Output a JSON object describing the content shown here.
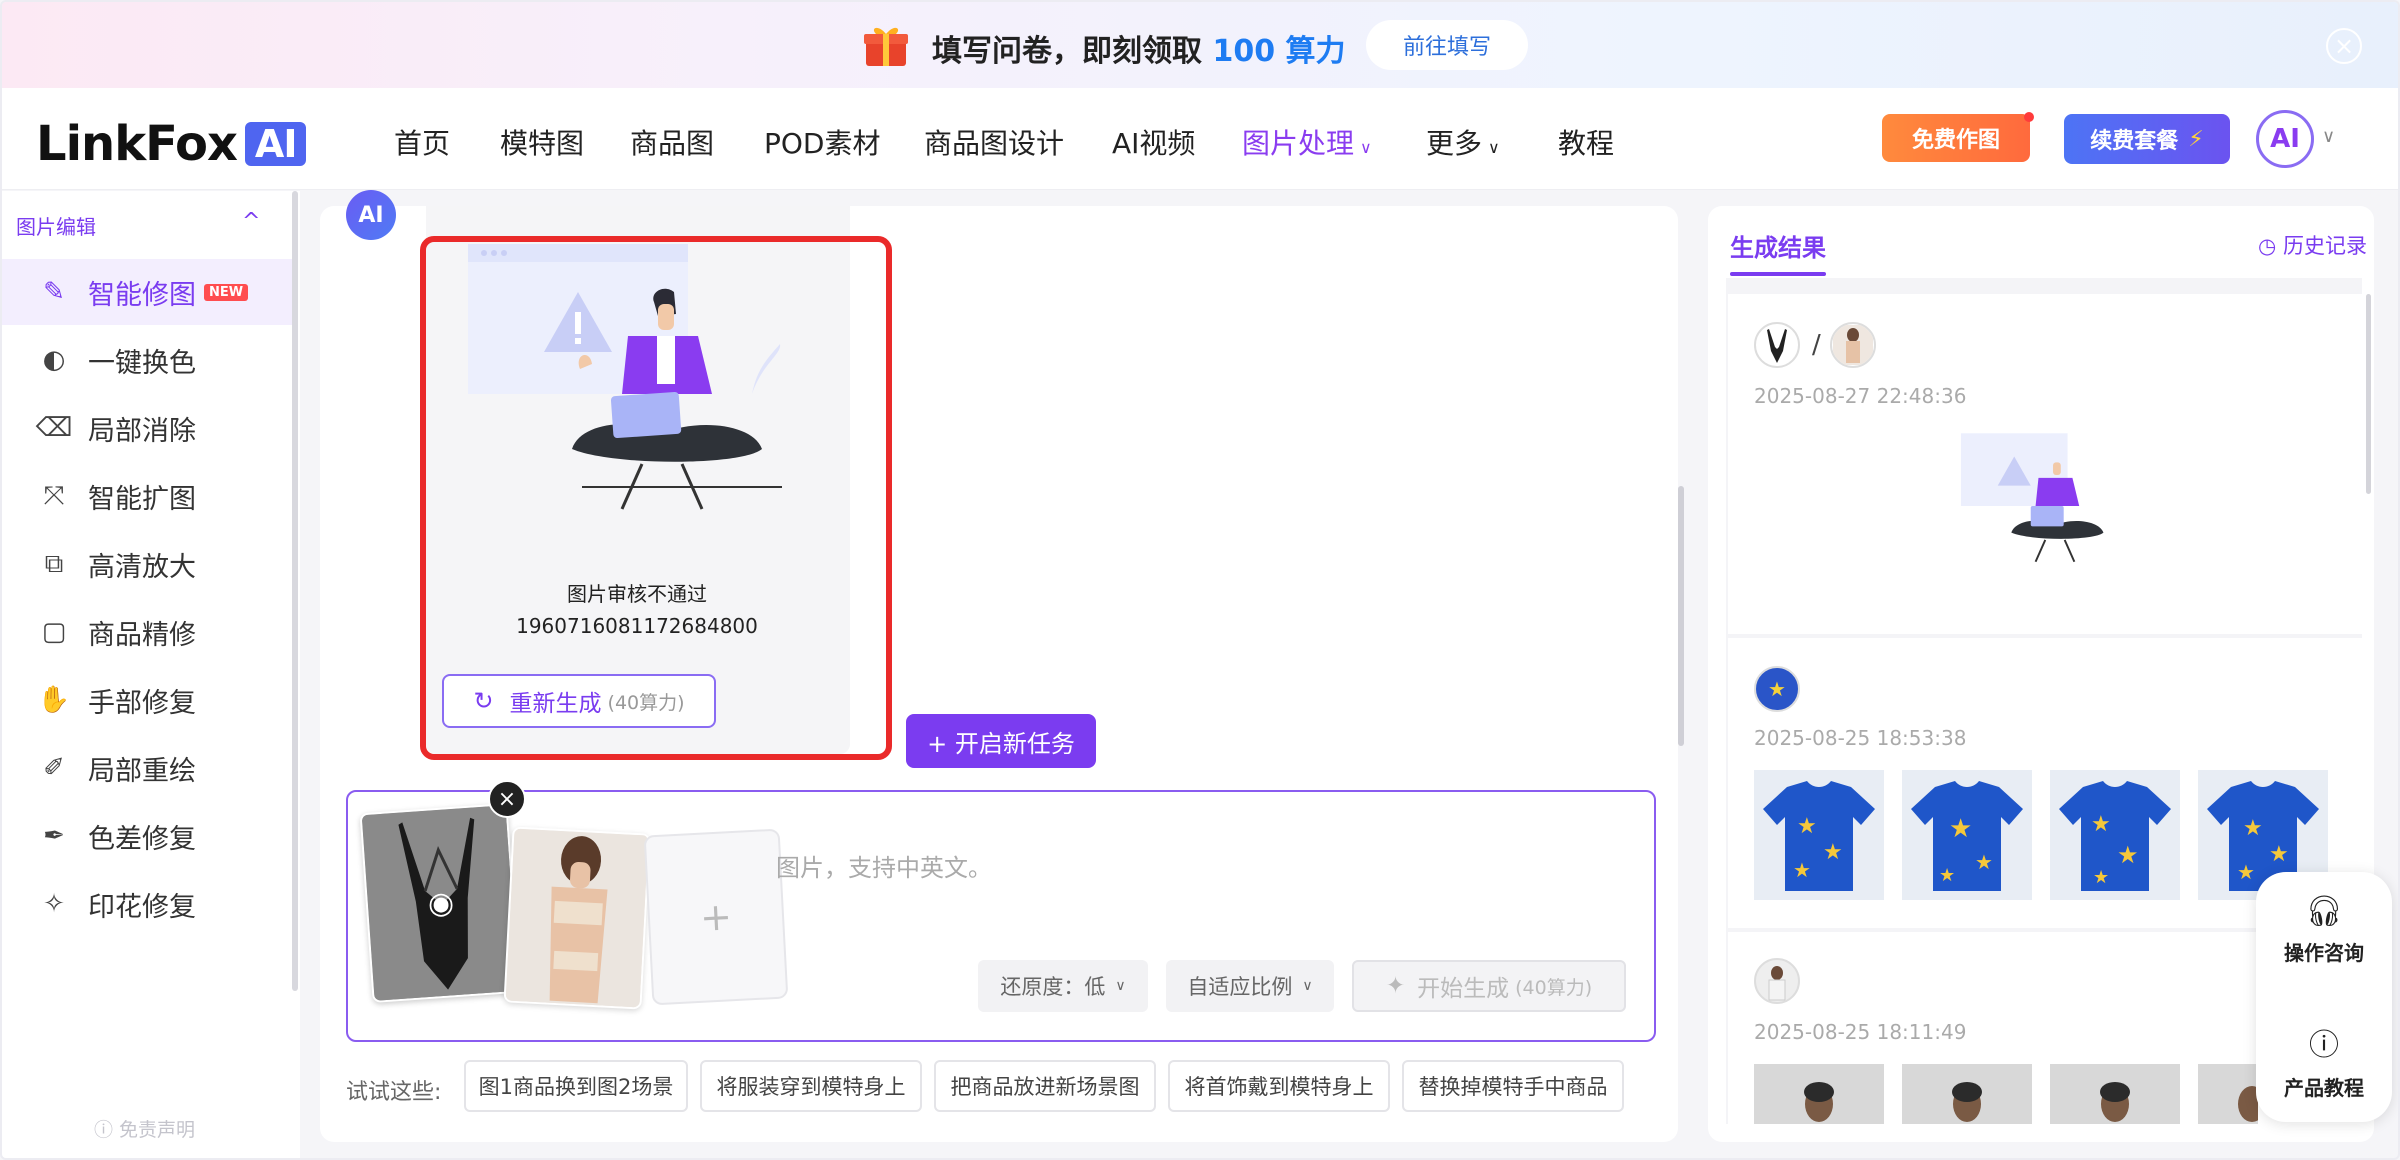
{
  "banner": {
    "text_prefix": "填写问卷，即刻领取",
    "text_highlight": "100 算力",
    "cta": "前往填写"
  },
  "nav": {
    "logo": "LinkFox",
    "logo_badge": "AI",
    "menu": [
      "首页",
      "模特图",
      "商品图",
      "POD素材",
      "商品图设计",
      "AI视频",
      "图片处理",
      "更多",
      "教程"
    ],
    "active_menu": "图片处理",
    "free_btn": "免费作图",
    "renew_btn": "续费套餐",
    "renew_icon": "⚡",
    "avatar_text": "AI"
  },
  "sidebar": {
    "group_title": "图片编辑",
    "items": [
      {
        "label": "智能修图",
        "icon": "magic-brush-icon",
        "active": true,
        "badge": "NEW"
      },
      {
        "label": "一键换色",
        "icon": "color-swap-icon"
      },
      {
        "label": "局部消除",
        "icon": "eraser-icon"
      },
      {
        "label": "智能扩图",
        "icon": "expand-icon"
      },
      {
        "label": "高清放大",
        "icon": "upscale-icon"
      },
      {
        "label": "商品精修",
        "icon": "retouch-icon"
      },
      {
        "label": "手部修复",
        "icon": "hand-icon"
      },
      {
        "label": "局部重绘",
        "icon": "repaint-icon"
      },
      {
        "label": "色差修复",
        "icon": "color-fix-icon"
      },
      {
        "label": "印花修复",
        "icon": "print-fix-icon"
      }
    ],
    "disclaimer": "免责声明"
  },
  "main": {
    "ai_badge": "AI",
    "result_card": {
      "status": "图片审核不通过",
      "id": "1960716081172684800",
      "regen_label": "重新生成",
      "regen_cost": "(40算力)"
    },
    "new_task": "+ 开启新任务",
    "input": {
      "placeholder": "图片，支持中英文。",
      "fidelity": "还原度：低",
      "ratio": "自适应比例",
      "generate_label": "开始生成",
      "generate_cost": "(40算力)"
    },
    "try_label": "试试这些:",
    "suggestions": [
      "图1商品换到图2场景",
      "将服装穿到模特身上",
      "把商品放进新场景图",
      "将首饰戴到模特身上",
      "替换掉模特手中商品"
    ]
  },
  "results": {
    "tab": "生成结果",
    "history": "历史记录",
    "entries": [
      {
        "time": "2025-08-27 22:48:36"
      },
      {
        "time": "2025-08-25 18:53:38"
      },
      {
        "time": "2025-08-25 18:11:49"
      }
    ]
  },
  "help": {
    "consult": "操作咨询",
    "tutorial": "产品教程"
  },
  "colors": {
    "accent": "#7a3cf0",
    "highlight_blue": "#1e7cf2",
    "error_frame": "#ea2a2a"
  }
}
